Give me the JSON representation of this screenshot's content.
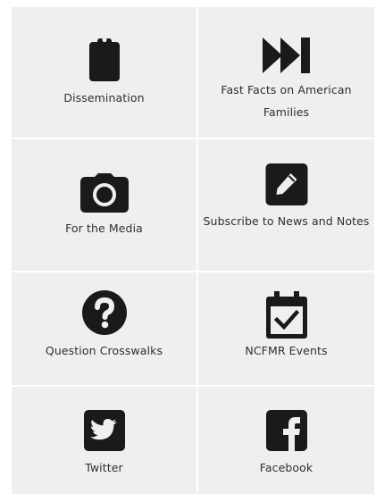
{
  "colors": {
    "tile_background": "#efefef",
    "icon": "#1a1a1a",
    "text": "#2f2f2f"
  },
  "tiles": [
    {
      "label": "Dissemination",
      "icon": "clipboard-icon"
    },
    {
      "label": "Fast Facts on American Families",
      "icon": "fast-forward-icon"
    },
    {
      "label": "For the Media",
      "icon": "camera-icon"
    },
    {
      "label": "Subscribe to News and Notes",
      "icon": "pencil-square-icon"
    },
    {
      "label": "Question Crosswalks",
      "icon": "question-circle-icon"
    },
    {
      "label": "NCFMR Events",
      "icon": "calendar-check-icon"
    },
    {
      "label": "Twitter",
      "icon": "twitter-icon"
    },
    {
      "label": "Facebook",
      "icon": "facebook-icon"
    }
  ]
}
